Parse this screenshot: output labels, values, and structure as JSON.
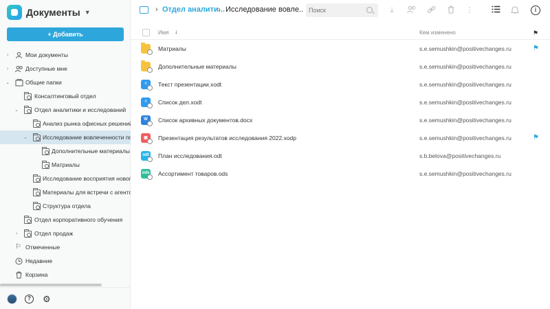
{
  "app": {
    "title": "Документы"
  },
  "sidebar": {
    "add_button": "+ Добавить",
    "tree": [
      {
        "label": "Мои документы",
        "icon": "my-docs-icon"
      },
      {
        "label": "Доступные мне",
        "icon": "shared-with-me-icon"
      },
      {
        "label": "Общие папки",
        "icon": "common-folders-icon"
      },
      {
        "label": "Консалтинговый отдел",
        "icon": "folder-icon"
      },
      {
        "label": "Отдел аналитики и исследований",
        "icon": "folder-icon"
      },
      {
        "label": "Анализ рынка офисных решений",
        "icon": "folder-icon"
      },
      {
        "label": "Исследование вовлеченности по",
        "icon": "folder-icon"
      },
      {
        "label": "Дополнительные материалы",
        "icon": "folder-icon"
      },
      {
        "label": "Матриалы",
        "icon": "folder-icon"
      },
      {
        "label": "Исследование восприятия нового",
        "icon": "folder-icon"
      },
      {
        "label": "Материалы для встречи с агентст",
        "icon": "folder-icon"
      },
      {
        "label": "Структура отдела",
        "icon": "folder-icon"
      },
      {
        "label": "Отдел корпоративного обучения",
        "icon": "folder-icon"
      },
      {
        "label": "Отдел продаж",
        "icon": "folder-icon"
      },
      {
        "label": "Отмеченные",
        "icon": "flag-icon"
      },
      {
        "label": "Недавние",
        "icon": "clock-icon"
      },
      {
        "label": "Корзина",
        "icon": "trash-icon"
      }
    ]
  },
  "header": {
    "breadcrumb_parent": "Отдел аналити...",
    "breadcrumb_current": "Исследование вовле...",
    "search_placeholder": "Поиск"
  },
  "table": {
    "col_name": "Имя",
    "col_modified_by": "Кем изменено",
    "rows": [
      {
        "name": "Матриалы",
        "modified_by": "s.e.semushkin@positivechanges.ru",
        "type": "folder",
        "flag": "⚑"
      },
      {
        "name": "Дополнительные материалы",
        "modified_by": "s.e.semushkin@positivechanges.ru",
        "type": "folder",
        "flag": ""
      },
      {
        "name": "Текст презентации.xodt",
        "modified_by": "s.e.semushkin@positivechanges.ru",
        "type": "doc",
        "flag": ""
      },
      {
        "name": "Список дел.xodt",
        "modified_by": "s.e.semushkin@positivechanges.ru",
        "type": "doc",
        "flag": ""
      },
      {
        "name": "Список архивных документов.docx",
        "modified_by": "s.e.semushkin@positivechanges.ru",
        "type": "word",
        "flag": ""
      },
      {
        "name": "Презентация результатов исследования 2022.xodp",
        "modified_by": "s.e.semushkin@positivechanges.ru",
        "type": "pres",
        "flag": "⚑"
      },
      {
        "name": "План исследования.odt",
        "modified_by": "s.b.belova@positivechanges.ru",
        "type": "odt",
        "flag": ""
      },
      {
        "name": "Ассортимент товаров.ods",
        "modified_by": "s.e.semushkin@positivechanges.ru",
        "type": "ods",
        "flag": ""
      }
    ]
  },
  "colors": {
    "accent": "#2da7db",
    "selected_row": "#d6e6f0"
  }
}
